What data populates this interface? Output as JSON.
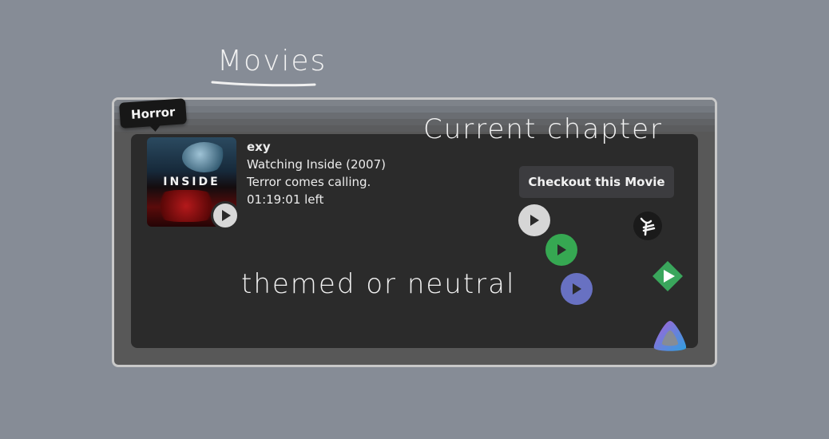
{
  "annotations": {
    "title": "Movies",
    "current_chapter": "Current chapter",
    "themed_or_neutral": "themed or neutral"
  },
  "card": {
    "tag": "Horror",
    "poster_title": "INSIDE",
    "username": "exy",
    "watching": "Watching Inside (2007)",
    "tagline": "Terror comes calling.",
    "time_left": "01:19:01 left",
    "checkout_label": "Checkout this Movie"
  },
  "play_buttons": [
    {
      "theme": "neutral",
      "color": "#d6d6d6"
    },
    {
      "theme": "green",
      "color": "#36a852"
    },
    {
      "theme": "purple",
      "color": "#6871c2"
    }
  ],
  "services": [
    "plex-icon",
    "green-diamond-play-icon",
    "jellyfin-icon"
  ]
}
